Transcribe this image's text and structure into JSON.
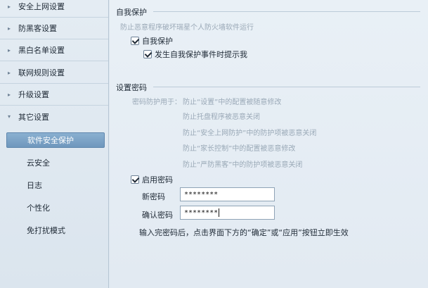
{
  "sidebar": {
    "categories": [
      {
        "label": "安全上网设置",
        "arrow": "▸"
      },
      {
        "label": "防黑客设置",
        "arrow": "▸"
      },
      {
        "label": "黑白名单设置",
        "arrow": "▸"
      },
      {
        "label": "联网规则设置",
        "arrow": "▸"
      },
      {
        "label": "升级设置",
        "arrow": "▸"
      },
      {
        "label": "其它设置",
        "arrow": "▾"
      }
    ],
    "subitems": [
      {
        "label": "软件安全保护",
        "selected": true
      },
      {
        "label": "云安全"
      },
      {
        "label": "日志"
      },
      {
        "label": "个性化"
      },
      {
        "label": "免打扰模式"
      }
    ]
  },
  "self_protect": {
    "title": "自我保护",
    "desc": "防止恶意程序破坏瑞星个人防火墙软件运行",
    "enable_label": "自我保护",
    "enable_checked": true,
    "notify_label": "发生自我保护事件时提示我",
    "notify_checked": true
  },
  "password": {
    "title": "设置密码",
    "purpose_prefix": "密码防护用于：",
    "purposes": [
      "防止“设置”中的配置被随意修改",
      "防止托盘程序被恶意关闭",
      "防止“安全上网防护”中的防护项被恶意关闭",
      "防止“家长控制”中的配置被恶意修改",
      "防止“严防黑客”中的防护项被恶意关闭"
    ],
    "enable_label": "启用密码",
    "enable_checked": true,
    "new_label": "新密码",
    "new_value": "********",
    "confirm_label": "确认密码",
    "confirm_value": "********",
    "hint": "输入完密码后，点击界面下方的“确定”或“应用”按钮立即生效"
  }
}
